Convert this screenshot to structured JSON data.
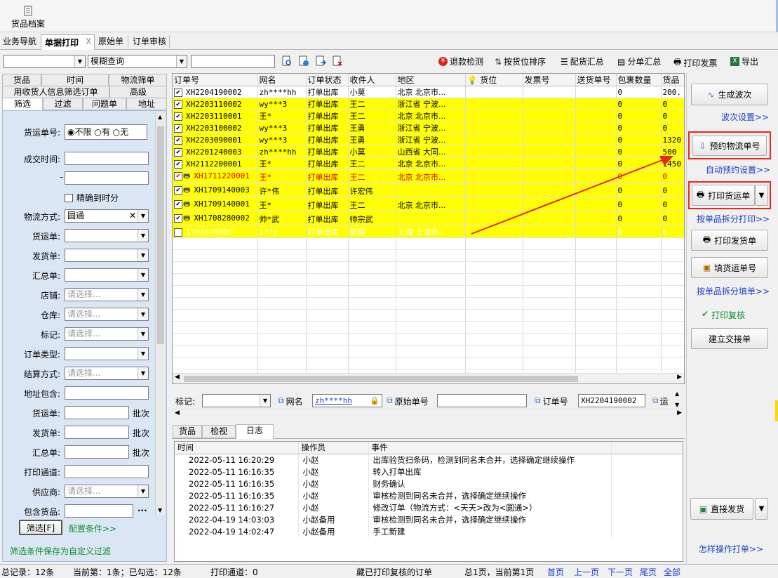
{
  "top": {
    "archive_label": "货品档案"
  },
  "nav_tabs": [
    "业务导航",
    "单据打印",
    "原始单",
    "订单审核"
  ],
  "toolbar": {
    "query_mode": "模糊查询",
    "buttons": [
      "退款检测",
      "按货位排序",
      "配货汇总",
      "分单汇总",
      "打印发票",
      "导出"
    ]
  },
  "left_tabs_row1": [
    "货品",
    "时间",
    "物流筛单"
  ],
  "left_tabs_row2": [
    "用收货人信息筛选订单",
    "高级"
  ],
  "left_tabs_row3": [
    "筛选",
    "过滤",
    "问题单",
    "地址"
  ],
  "filter": {
    "huoyun_label": "货运单号:",
    "radio": [
      "不限",
      "有",
      "无"
    ],
    "deal_time_label": "成交时间:",
    "dash": "-",
    "precise_label": "精确到时分",
    "logistics_label": "物流方式:",
    "logistics_value": "圆通",
    "fields": [
      "货运单:",
      "发货单:",
      "汇总单:"
    ],
    "store_label": "店铺:",
    "warehouse_label": "仓库:",
    "mark_label": "标记:",
    "placeholder": "请选择...",
    "order_type_label": "订单类型:",
    "settle_label": "结算方式:",
    "addr_label": "地址包含:",
    "batch_fields": [
      "货运单:",
      "发货单:",
      "汇总单:"
    ],
    "batch": "批次",
    "print_channel_label": "打印通道:",
    "supplier_label": "供应商:",
    "goods_label": "包含货品:",
    "ellipsis": "...",
    "filter_btn": "筛选[F]",
    "config_link": "配置条件>>",
    "save_note": "筛选条件保存为自定义过滤"
  },
  "grid": {
    "headers": [
      "订单号",
      "网名",
      "订单状态",
      "收件人",
      "地区",
      "货位",
      "发票号",
      "送货单号",
      "包裹数量",
      "货品"
    ],
    "rows": [
      {
        "no": "XH2204190002",
        "name": "zh****hh",
        "status": "打单出库",
        "rcv": "小莫",
        "area": "北京 北京市...",
        "pkg": "0",
        "goods": "200.",
        "bg": "#ffffff",
        "color": "#000000",
        "icon": ""
      },
      {
        "no": "XH2203110002",
        "name": "wy***3",
        "status": "打单出库",
        "rcv": "王二",
        "area": "浙江省 宁波...",
        "pkg": "0",
        "goods": "0",
        "bg": "#ffff00",
        "color": "#000000",
        "icon": ""
      },
      {
        "no": "XH2203110001",
        "name": "王*",
        "status": "打单出库",
        "rcv": "王二",
        "area": "北京 北京市...",
        "pkg": "0",
        "goods": "0",
        "bg": "#ffff00",
        "color": "#000000",
        "icon": ""
      },
      {
        "no": "XH2203100002",
        "name": "wy***3",
        "status": "打单出库",
        "rcv": "王勇",
        "area": "浙江省 宁波...",
        "pkg": "0",
        "goods": "0",
        "bg": "#ffff00",
        "color": "#000000",
        "icon": ""
      },
      {
        "no": "XH2203090001",
        "name": "wy***3",
        "status": "打单出库",
        "rcv": "王勇",
        "area": "浙江省 宁波...",
        "pkg": "0",
        "goods": "1320",
        "bg": "#ffff00",
        "color": "#000000",
        "icon": ""
      },
      {
        "no": "XH2201240003",
        "name": "zh****hh",
        "status": "打单出库",
        "rcv": "小莫",
        "area": "山西省 大同...",
        "pkg": "0",
        "goods": "500",
        "bg": "#ffff00",
        "color": "#000000",
        "icon": ""
      },
      {
        "no": "XH2112200001",
        "name": "王*",
        "status": "打单出库",
        "rcv": "王二",
        "area": "北京 北京市...",
        "pkg": "0",
        "goods": "1450",
        "bg": "#ffff00",
        "color": "#000000",
        "icon": ""
      },
      {
        "no": "XH1711220001",
        "name": "王*",
        "status": "打单出库",
        "rcv": "王二",
        "area": "北京 北京市...",
        "pkg": "0",
        "goods": "0",
        "bg": "#ffff00",
        "color": "#e00000",
        "icon": "printer"
      },
      {
        "no": "XH1709140003",
        "name": "许*伟",
        "status": "打单出库",
        "rcv": "许宏伟",
        "area": "",
        "pkg": "0",
        "goods": "0",
        "bg": "#ffff00",
        "color": "#000000",
        "icon": "printer"
      },
      {
        "no": "XH1709140001",
        "name": "王*",
        "status": "打单出库",
        "rcv": "王二",
        "area": "北京 北京市...",
        "pkg": "0",
        "goods": "0",
        "bg": "#ffff00",
        "color": "#000000",
        "icon": "printer-lock"
      },
      {
        "no": "XH1708280002",
        "name": "帅*武",
        "status": "打单出库",
        "rcv": "帅宗武",
        "area": "",
        "pkg": "0",
        "goods": "0",
        "bg": "#ffff00",
        "color": "#000000",
        "icon": "printer"
      },
      {
        "no": "1704070003",
        "name": "1**y",
        "status": "打单出库",
        "rcv": "前解",
        "area": "上海 上海市...",
        "pkg": "0",
        "goods": "0",
        "bg": "#ffff00",
        "color": "#ffffff",
        "icon": ""
      }
    ]
  },
  "detail": {
    "mark_label": "标记:",
    "wangming_label": "网名",
    "wangming_value": "zh****hh",
    "orig_label": "原始单号",
    "order_label": "订单号",
    "order_value": "XH2204190002",
    "trailing": "运"
  },
  "bottom_tabs": [
    "货品",
    "检视",
    "日志"
  ],
  "log": {
    "headers": [
      "时间",
      "操作员",
      "事件"
    ],
    "rows": [
      [
        "2022-05-11 16:20:29",
        "小赵",
        "出库验货扫条码，检测到同名未合并，选择确定继续操作"
      ],
      [
        "2022-05-11 16:16:35",
        "小赵",
        "转入打单出库"
      ],
      [
        "2022-05-11 16:16:35",
        "小赵",
        "财务确认"
      ],
      [
        "2022-05-11 16:16:35",
        "小赵",
        "审核检测到同名未合并，选择确定继续操作"
      ],
      [
        "2022-05-11 16:16:27",
        "小赵",
        "修改订单（物流方式：<天天>改为<圆通>）"
      ],
      [
        "2022-04-19 14:03:03",
        "小赵备用",
        "审核检测到同名未合并，选择确定继续操作"
      ],
      [
        "2022-04-19 14:02:47",
        "小赵备用",
        "手工新建"
      ]
    ]
  },
  "right": {
    "gen_wave": "生成波次",
    "wave_settings": "波次设置>>",
    "reserve": "预约物流单号",
    "auto_reserve": "自动预约设置>>",
    "print_waybill": "打印货运单",
    "split_print": "按单品拆分打印>>",
    "print_delivery": "打印发货单",
    "fill_waybill": "填货运单号",
    "split_fill": "按单品拆分填单>>",
    "print_review": "打印复核",
    "handover": "建立交接单",
    "direct_ship": "直接发货",
    "how_print": "怎样操作打单>>"
  },
  "status": {
    "total": "总记录：12条",
    "current": "当前第：1条；已勾选：12条",
    "channel": "打印通道：0",
    "hide": "藏已打印复核的订单",
    "pages": "总1页，当前第1页",
    "first": "首页",
    "prev": "上一页",
    "next": "下一页",
    "last": "尾页",
    "all": "全部"
  },
  "colors": {
    "highlight": "#ffff00",
    "annotation": "#e8281e",
    "link": "#1a3fc8"
  }
}
